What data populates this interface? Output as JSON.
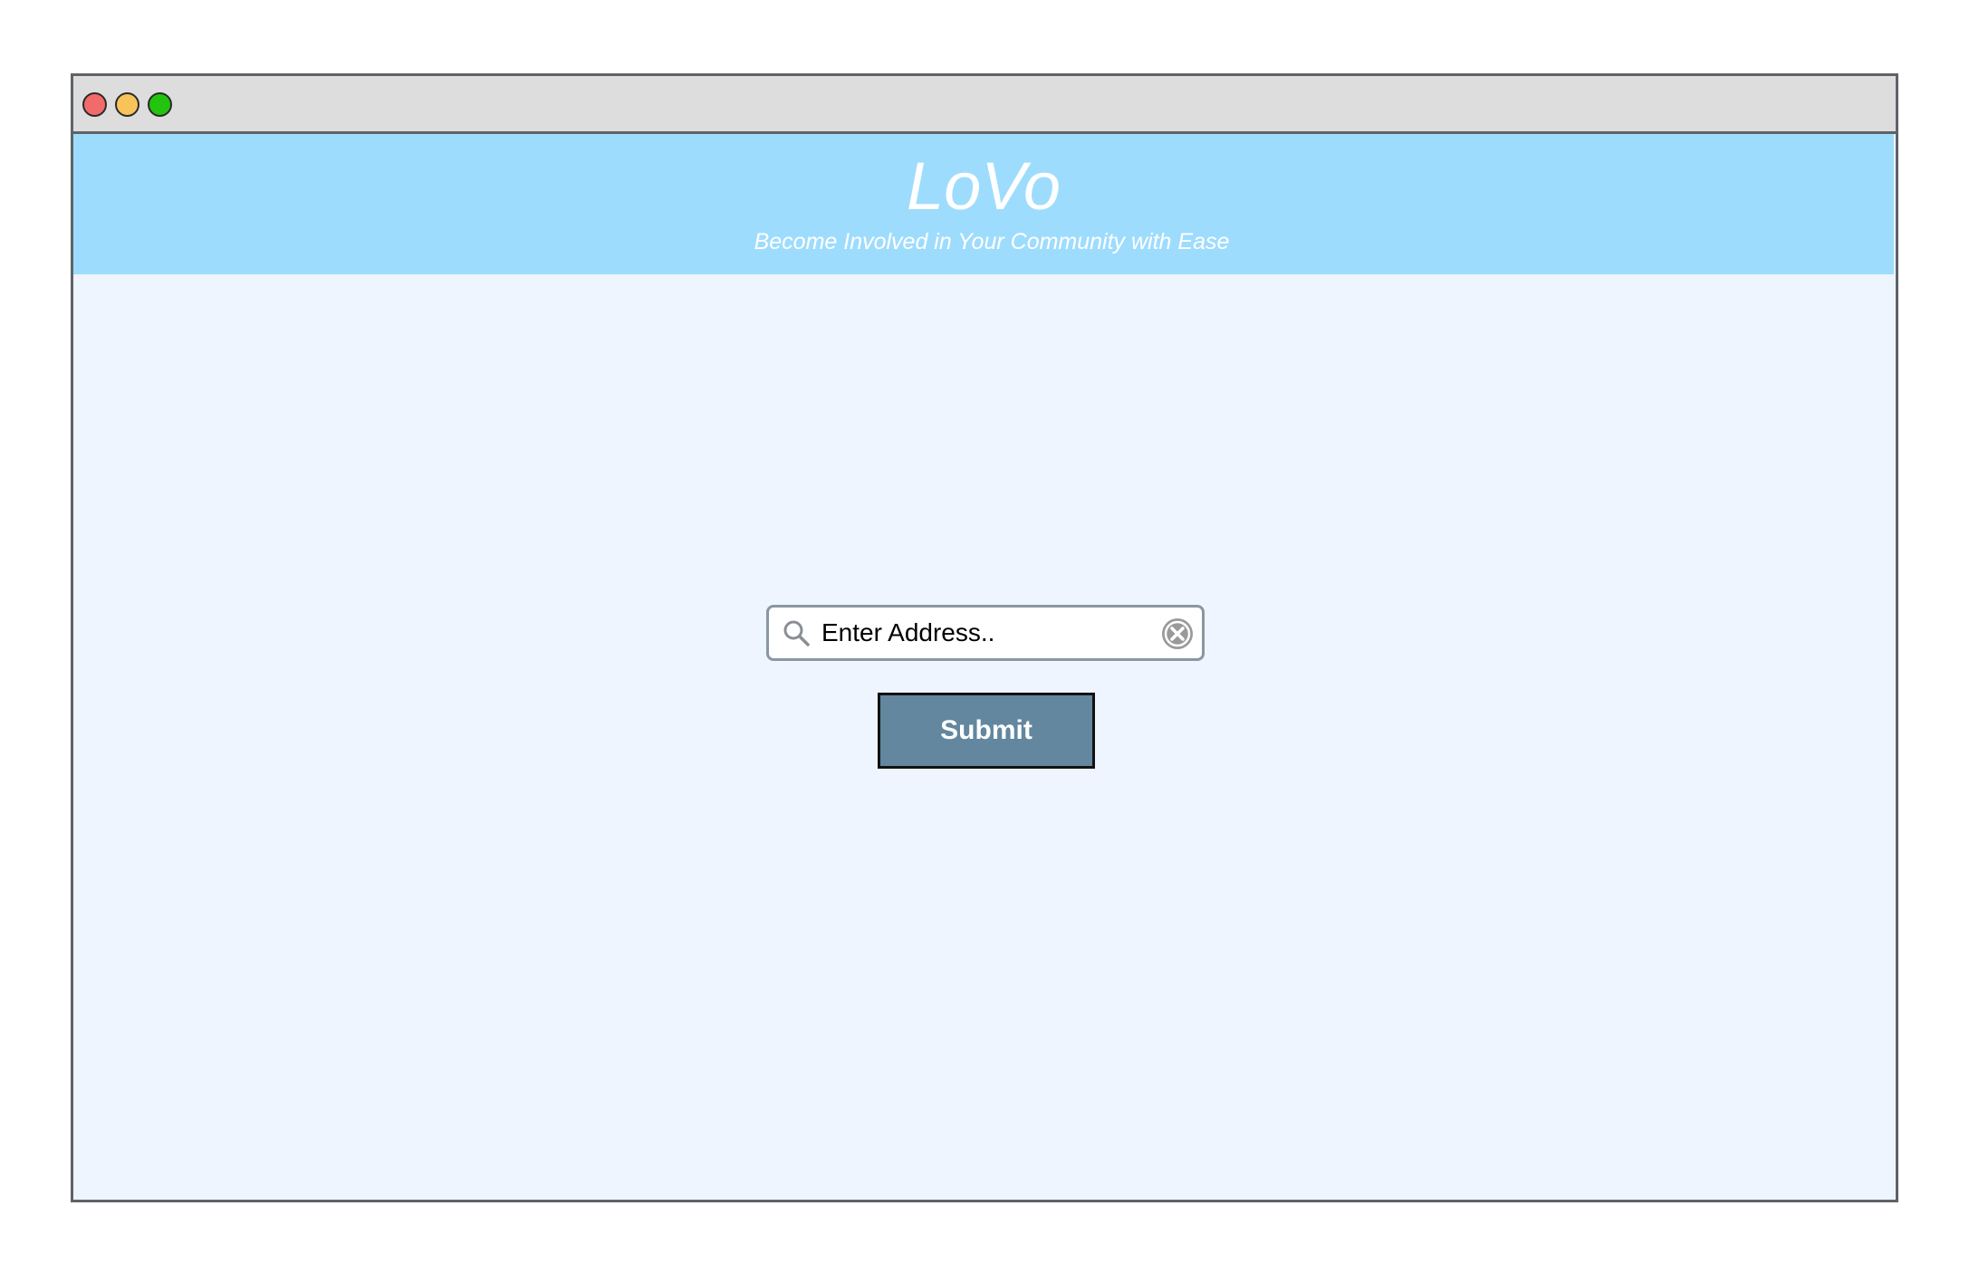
{
  "window": {
    "controls": [
      "close",
      "minimize",
      "maximize"
    ]
  },
  "header": {
    "logo": "LoVo",
    "tagline": "Become Involved in Your Community with Ease"
  },
  "search": {
    "placeholder": "Enter Address..",
    "value": "",
    "icon": "search-icon",
    "clear_icon": "clear-icon"
  },
  "actions": {
    "submit_label": "Submit"
  },
  "colors": {
    "banner": "#9edcfd",
    "content_background": "#eef5fe",
    "submit_button": "#62879e",
    "close_dot": "#f26b6b",
    "minimize_dot": "#f8c45a",
    "maximize_dot": "#22c40e"
  }
}
